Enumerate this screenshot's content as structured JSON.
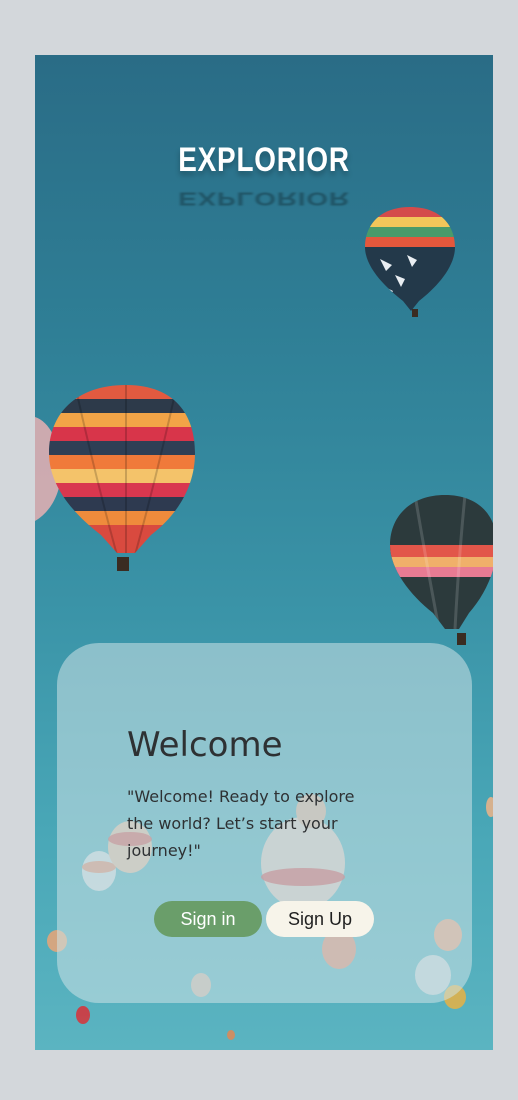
{
  "app": {
    "logo_text": "EXPLORIOR"
  },
  "welcome": {
    "title": "Welcome",
    "message": "\"Welcome! Ready to explore the world? Let’s start your journey!\""
  },
  "actions": {
    "signin_label": "Sign in",
    "signup_label": "Sign Up"
  },
  "colors": {
    "signin_button": "#6a9e6a",
    "signup_button": "#f7f4ea",
    "sky_top": "#2a6c86",
    "sky_bottom": "#5bb4c1"
  }
}
